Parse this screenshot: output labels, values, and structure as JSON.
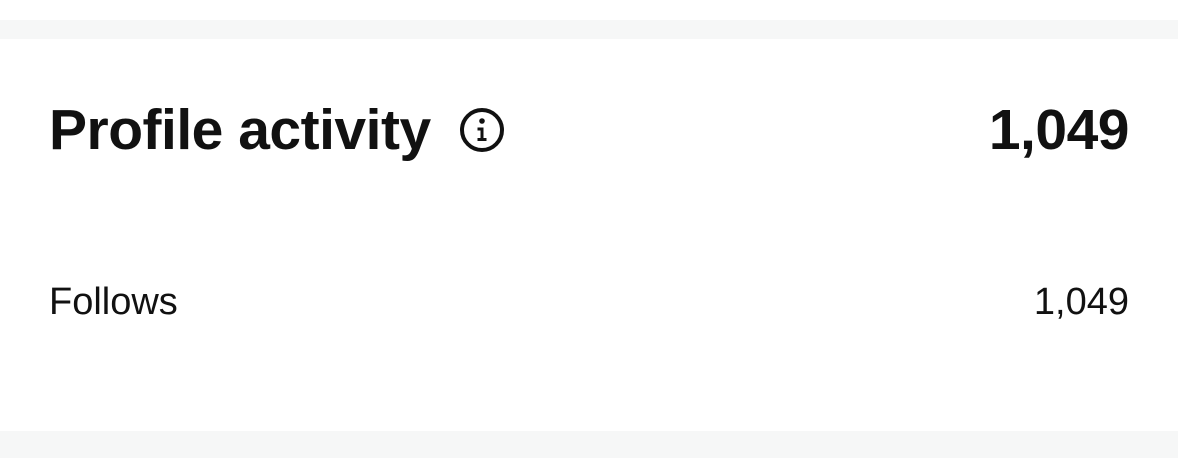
{
  "section": {
    "title": "Profile activity",
    "total": "1,049",
    "info_icon": "info-circle-icon"
  },
  "metrics": [
    {
      "label": "Follows",
      "value": "1,049"
    }
  ]
}
